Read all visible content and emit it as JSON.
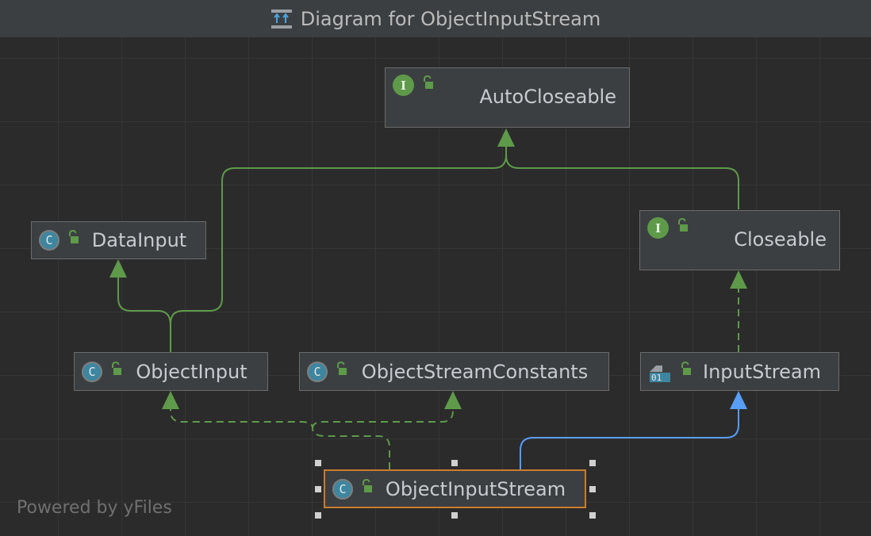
{
  "window": {
    "title": "Diagram for ObjectInputStream",
    "title_icon": "diagram-icon"
  },
  "nodes": {
    "autocloseable": {
      "label": "AutoCloseable",
      "kind": "interface",
      "icons": [
        "interface-icon",
        "public-lock-icon"
      ]
    },
    "closeable": {
      "label": "Closeable",
      "kind": "interface",
      "icons": [
        "interface-icon",
        "public-lock-icon"
      ]
    },
    "datainput": {
      "label": "DataInput",
      "kind": "class",
      "icons": [
        "class-icon",
        "public-lock-icon"
      ]
    },
    "objectinput": {
      "label": "ObjectInput",
      "kind": "class",
      "icons": [
        "class-icon",
        "public-lock-icon"
      ]
    },
    "objectstreamconstants": {
      "label": "ObjectStreamConstants",
      "kind": "class",
      "icons": [
        "class-icon",
        "public-lock-icon"
      ]
    },
    "inputstream": {
      "label": "InputStream",
      "kind": "abstract-class",
      "icons": [
        "abstract-class-icon",
        "public-lock-icon"
      ]
    },
    "objectinputstream": {
      "label": "ObjectInputStream",
      "kind": "class",
      "selected": true,
      "icons": [
        "class-icon",
        "public-lock-icon"
      ]
    }
  },
  "icon_letters": {
    "class": "C",
    "interface": "I",
    "abstract_binary": "01"
  },
  "footer": {
    "powered_by": "Powered by yFiles"
  },
  "colors": {
    "background": "#2b2b2b",
    "titlebar": "#3c3f41",
    "node_fill": "#3c3f41",
    "node_border": "#6b6b6b",
    "selected_border": "#c77c30",
    "interface_edge": "#5e9a4a",
    "extends_edge": "#589df6",
    "class_icon": "#3e86a0",
    "interface_icon": "#5e9a4a"
  },
  "edges": [
    {
      "from": "Closeable",
      "to": "AutoCloseable",
      "style": "solid",
      "color": "green"
    },
    {
      "from": "ObjectInput",
      "to": "AutoCloseable",
      "style": "solid",
      "color": "green"
    },
    {
      "from": "ObjectInput",
      "to": "DataInput",
      "style": "solid",
      "color": "green"
    },
    {
      "from": "InputStream",
      "to": "Closeable",
      "style": "dashed",
      "color": "green"
    },
    {
      "from": "ObjectInputStream",
      "to": "ObjectInput",
      "style": "dashed",
      "color": "green"
    },
    {
      "from": "ObjectInputStream",
      "to": "ObjectStreamConstants",
      "style": "dashed",
      "color": "green"
    },
    {
      "from": "ObjectInputStream",
      "to": "InputStream",
      "style": "solid",
      "color": "blue"
    }
  ]
}
